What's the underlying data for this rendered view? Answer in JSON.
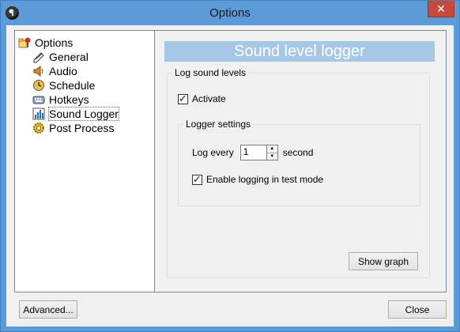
{
  "window": {
    "title": "Options"
  },
  "tree": {
    "root_label": "Options",
    "items": [
      {
        "label": "General",
        "icon": "pencil-icon"
      },
      {
        "label": "Audio",
        "icon": "speaker-icon"
      },
      {
        "label": "Schedule",
        "icon": "clock-icon"
      },
      {
        "label": "Hotkeys",
        "icon": "keyboard-icon"
      },
      {
        "label": "Sound Logger",
        "icon": "bar-chart-icon"
      },
      {
        "label": "Post Process",
        "icon": "gear-icon"
      }
    ],
    "selected": "Sound Logger"
  },
  "panel": {
    "banner": "Sound level logger",
    "log_group": {
      "label": "Log sound levels",
      "activate_label": "Activate",
      "activate_checked": true
    },
    "logger_group": {
      "label": "Logger settings",
      "log_every_label": "Log every",
      "log_every_value": "1",
      "unit_label": "second",
      "test_mode_label": "Enable logging in test mode",
      "test_mode_checked": true
    },
    "show_graph_label": "Show graph"
  },
  "footer": {
    "advanced_label": "Advanced...",
    "close_label": "Close"
  },
  "colors": {
    "title_bar": "#5d9bd8",
    "banner": "#a6c8e6",
    "close_button": "#c7493a"
  }
}
